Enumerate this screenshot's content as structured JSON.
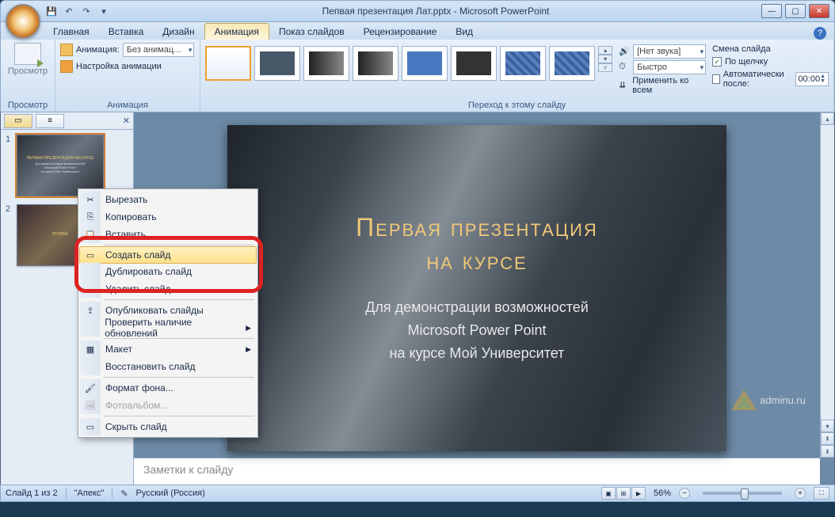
{
  "titlebar": {
    "title": "Пепвая презентация Лат.pptx - Microsoft PowerPoint"
  },
  "tabs": {
    "home": "Главная",
    "insert": "Вставка",
    "design": "Дизайн",
    "animation": "Анимация",
    "slideshow": "Показ слайдов",
    "review": "Рецензирование",
    "view": "Вид"
  },
  "ribbon": {
    "preview_group": "Просмотр",
    "preview_btn": "Просмотр",
    "animation_group": "Анимация",
    "animation_label": "Анимация:",
    "animation_value": "Без анимац...",
    "custom_anim": "Настройка анимации",
    "transition_group": "Переход к этому слайду",
    "sound_icon": "🔊",
    "sound_value": "[Нет звука]",
    "speed_value": "Быстро",
    "apply_all": "Применить ко всем",
    "advance_title": "Смена слайда",
    "on_click": "По щелчку",
    "auto_after": "Автоматически после:",
    "time_value": "00:00"
  },
  "thumbnails": {
    "slide1": {
      "num": "1",
      "title": "ПЕРВАЯ ПРЕЗЕНТАЦИЯ НА КУРСЕ",
      "sub1": "Для демонстрации возможностей",
      "sub2": "Microsoft Power Point",
      "sub3": "на курсе Мой Университет"
    },
    "slide2": {
      "num": "2",
      "title": "ВТОРАЯ"
    }
  },
  "context_menu": {
    "cut": "Вырезать",
    "copy": "Копировать",
    "paste": "Вставить",
    "new_slide": "Создать слайд",
    "duplicate": "Дублировать слайд",
    "delete": "Удалить слайд",
    "publish": "Опубликовать слайды",
    "check_updates": "Проверить наличие обновлений",
    "layout": "Макет",
    "reset": "Восстановить слайд",
    "format_bg": "Формат фона...",
    "photo_album": "Фотоальбом...",
    "hide": "Скрыть слайд"
  },
  "slide": {
    "title_line1": "Первая презентация",
    "title_line2": "на курсе",
    "sub_line1": "Для демонстрации возможностей",
    "sub_line2": "Microsoft Power Point",
    "sub_line3": "на курсе Мой Университет"
  },
  "notes": {
    "placeholder": "Заметки к слайду"
  },
  "statusbar": {
    "slide_info": "Слайд 1 из 2",
    "theme": "\"Апекс\"",
    "language": "Русский (Россия)",
    "zoom": "56%"
  },
  "watermark": "adminu.ru"
}
